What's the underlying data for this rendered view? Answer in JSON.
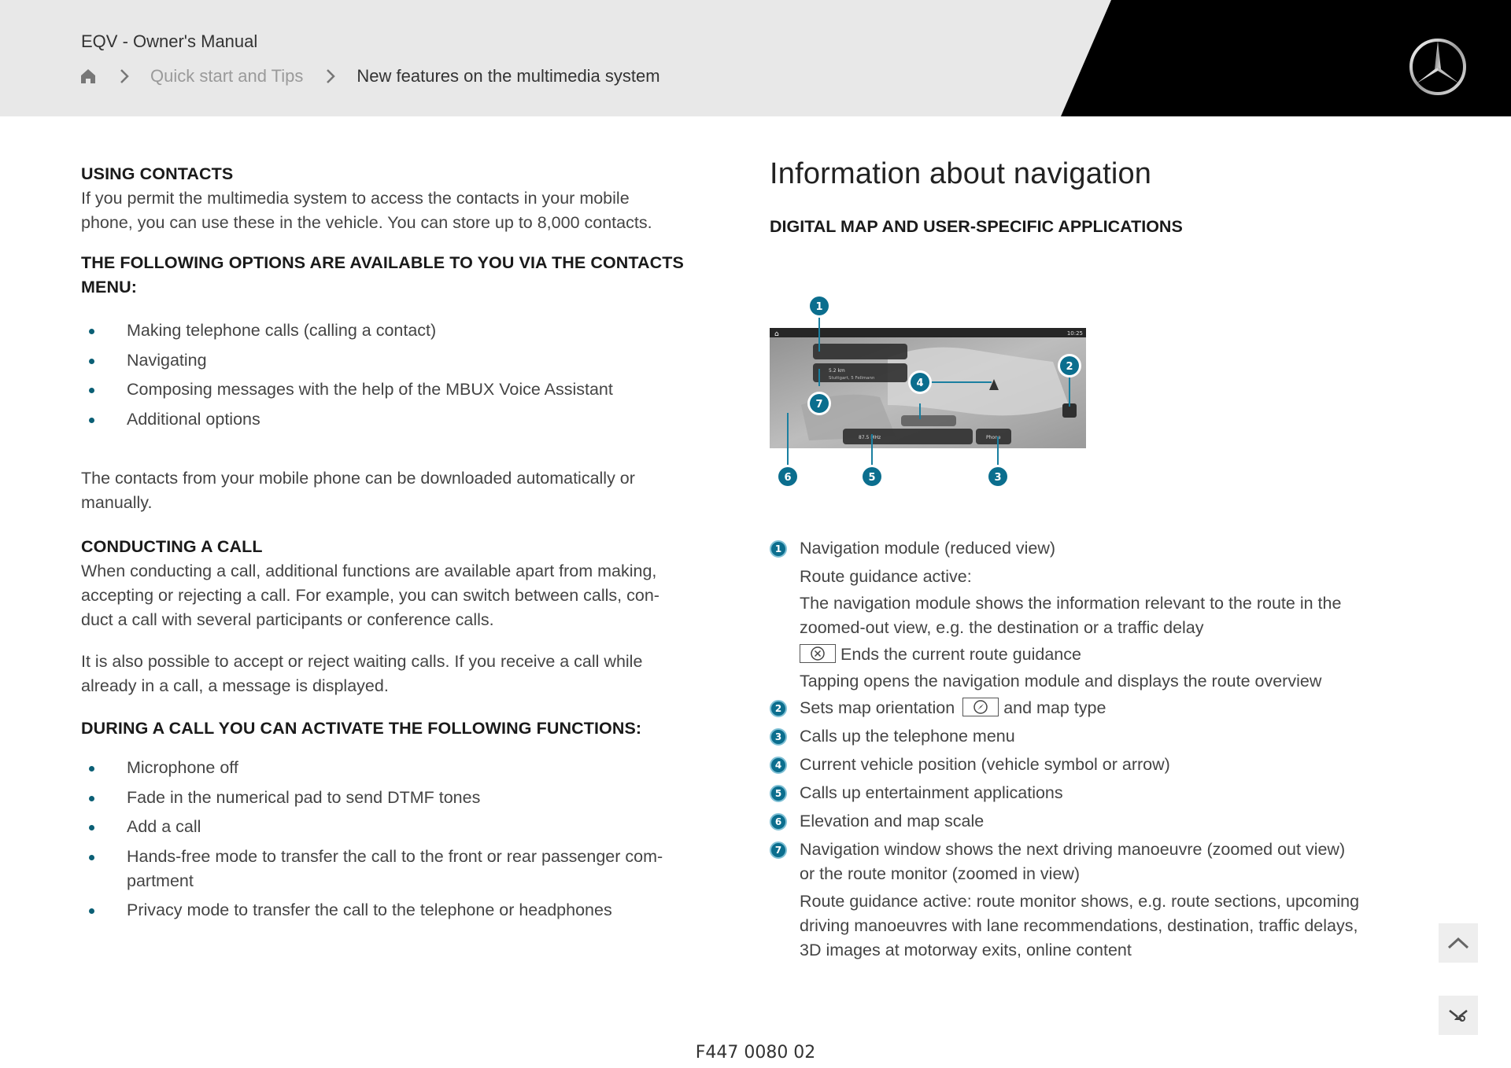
{
  "header": {
    "title": "EQV - Owner's Manual",
    "breadcrumb": {
      "home_icon": "home-icon",
      "separator_icon": "chevron-right-icon",
      "items": [
        {
          "label": "Quick start and Tips"
        },
        {
          "label": "New features on the multimedia system"
        }
      ]
    },
    "logo_icon": "mercedes-star-icon",
    "colors": {
      "band": "#e8e8e8",
      "black_panel": "#000000"
    }
  },
  "left": {
    "using_contacts": {
      "heading": "USING CONTACTS",
      "text_lines": [
        "If you permit the multimedia system to access the contacts in your mobile",
        "phone, you can use these in the vehicle. You can store up to 8,000 contacts."
      ]
    },
    "contacts_menu": {
      "heading_lines": [
        "THE FOLLOWING OPTIONS ARE AVAILABLE TO YOU VIA THE CONTACTS",
        "MENU:"
      ],
      "items": [
        {
          "label": "Making telephone calls (calling a contact)"
        },
        {
          "label": "Navigating"
        },
        {
          "label": "Composing messages with the help of the MBUX Voice Assistant"
        },
        {
          "label": "Additional options"
        }
      ]
    },
    "download_note_lines": [
      "The contacts from your mobile phone can be downloaded automatically or",
      "manually."
    ],
    "conducting_call": {
      "heading": "CONDUCTING A CALL",
      "text_lines": [
        "When conducting a call, additional functions are available apart from making,",
        "accepting or rejecting a call. For example, you can switch between calls, con-",
        "duct a call with several participants or conference calls."
      ],
      "waiting_lines": [
        "It is also possible to accept or reject waiting calls. If you receive a call while",
        "already in a call, a message is displayed."
      ]
    },
    "during_call": {
      "heading": "DURING A CALL YOU CAN ACTIVATE THE FOLLOWING FUNCTIONS:",
      "items": [
        {
          "lines": [
            "Microphone off"
          ]
        },
        {
          "lines": [
            "Fade in the numerical pad to send DTMF tones"
          ]
        },
        {
          "lines": [
            "Add a call"
          ]
        },
        {
          "lines": [
            "Hands-free mode to transfer the call to the front or rear passenger com-",
            "partment"
          ]
        },
        {
          "lines": [
            "Privacy mode to transfer the call to the telephone or headphones"
          ]
        }
      ]
    },
    "bullet_color": "#0b5f75"
  },
  "right": {
    "title": "Information about navigation",
    "subheading": "DIGITAL MAP AND USER-SPECIFIC APPLICATIONS",
    "diagram": {
      "callouts": [
        "1",
        "2",
        "3",
        "4",
        "5",
        "6",
        "7"
      ],
      "screen": {
        "clock": "10:25",
        "radio_station": "87.5 MHz",
        "phone_label": "Phone",
        "nav_line": "Stuttgart, 5 Fellmann",
        "distance": "5.2 km"
      },
      "callout_color": "#0b6e8e"
    },
    "legend": [
      {
        "num": "1",
        "label": "Navigation module (reduced view)",
        "sub": [
          {
            "type": "text",
            "text": "Route guidance active:"
          },
          {
            "type": "text",
            "text": "The navigation module shows the information relevant to the route in the"
          },
          {
            "type": "text",
            "text": "zoomed-out view, e.g. the destination or a traffic delay"
          },
          {
            "type": "icon",
            "icon": "close-circle-icon",
            "text": "Ends the current route guidance"
          },
          {
            "type": "text",
            "text": "Tapping opens the navigation module and displays the route overview"
          }
        ]
      },
      {
        "num": "2",
        "label_before": "Sets map orientation",
        "icon": "compass-icon",
        "label_after": "and map type"
      },
      {
        "num": "3",
        "label": "Calls up the telephone menu"
      },
      {
        "num": "4",
        "label": "Current vehicle position (vehicle symbol or arrow)"
      },
      {
        "num": "5",
        "label": "Calls up entertainment applications"
      },
      {
        "num": "6",
        "label": "Elevation and map scale"
      },
      {
        "num": "7",
        "label": "Navigation window shows the next driving manoeuvre (zoomed out view)",
        "sub": [
          {
            "type": "text",
            "text": "or the route monitor (zoomed in view)"
          },
          {
            "type": "text",
            "text": "Route guidance active: route monitor shows, e.g. route sections, upcoming"
          },
          {
            "type": "text",
            "text": "driving manoeuvres with lane recommendations, destination, traffic delays,"
          },
          {
            "type": "text",
            "text": "3D images at motorway exits, online content"
          }
        ]
      }
    ]
  },
  "controls": {
    "scroll_top_icon": "chevron-up-icon",
    "tools_icon": "tools-icon"
  },
  "footer": {
    "code": "F447 0080 02"
  }
}
